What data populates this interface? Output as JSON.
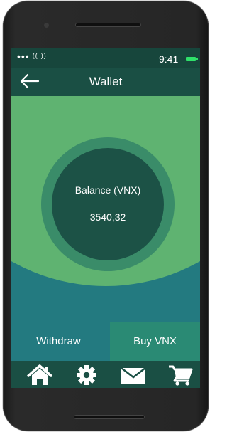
{
  "status_bar": {
    "signal": "•••",
    "wifi": "((·))",
    "time": "9:41"
  },
  "header": {
    "back_icon": "arrow-left-icon",
    "title": "Wallet"
  },
  "balance": {
    "label": "Balance (VNX)",
    "value": "3540,32"
  },
  "actions": {
    "withdraw_label": "Withdraw",
    "buy_label": "Buy VNX"
  },
  "tab_bar": {
    "items": [
      {
        "icon": "home-icon"
      },
      {
        "icon": "gear-icon"
      },
      {
        "icon": "mail-icon"
      },
      {
        "icon": "cart-icon"
      }
    ]
  },
  "colors": {
    "header_bg": "#1a4f44",
    "circle_green": "#5fb371",
    "ring": "#3a8c69",
    "inner_circle": "#1c5246",
    "withdraw_bg": "#237a80",
    "buy_bg": "#2a8a74",
    "battery": "#2fe06a"
  }
}
